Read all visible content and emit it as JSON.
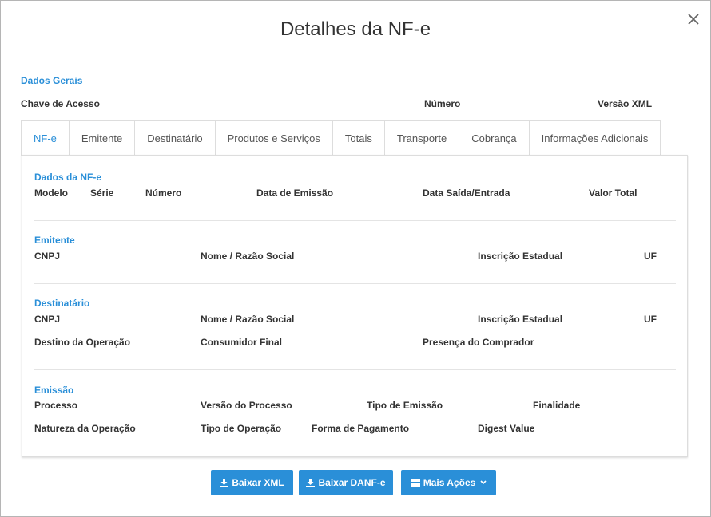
{
  "modal": {
    "title": "Detalhes da NF-e"
  },
  "general": {
    "section_title": "Dados Gerais",
    "access_key_label": "Chave de Acesso",
    "number_label": "Número",
    "xml_version_label": "Versão XML"
  },
  "tabs": [
    {
      "label": "NF-e",
      "active": true
    },
    {
      "label": "Emitente",
      "active": false
    },
    {
      "label": "Destinatário",
      "active": false
    },
    {
      "label": "Produtos e Serviços",
      "active": false
    },
    {
      "label": "Totais",
      "active": false
    },
    {
      "label": "Transporte",
      "active": false
    },
    {
      "label": "Cobrança",
      "active": false
    },
    {
      "label": "Informações Adicionais",
      "active": false
    }
  ],
  "nfe": {
    "title": "Dados da NF-e",
    "model": "Modelo",
    "series": "Série",
    "number": "Número",
    "issue_date": "Data de Emissão",
    "exit_entry_date": "Data Saída/Entrada",
    "total_value": "Valor Total"
  },
  "issuer": {
    "title": "Emitente",
    "cnpj": "CNPJ",
    "name": "Nome / Razão Social",
    "state_registration": "Inscrição Estadual",
    "uf": "UF"
  },
  "recipient": {
    "title": "Destinatário",
    "cnpj": "CNPJ",
    "name": "Nome / Razão Social",
    "state_registration": "Inscrição Estadual",
    "uf": "UF",
    "operation_destination": "Destino da Operação",
    "final_consumer": "Consumidor Final",
    "buyer_presence": "Presença do Comprador"
  },
  "emission": {
    "title": "Emissão",
    "process": "Processo",
    "process_version": "Versão do Processo",
    "emission_type": "Tipo de Emissão",
    "purpose": "Finalidade",
    "operation_nature": "Natureza da Operação",
    "operation_type": "Tipo de Operação",
    "payment_method": "Forma de Pagamento",
    "digest_value": "Digest Value"
  },
  "buttons": {
    "download_xml": "Baixar XML",
    "download_danfe": "Baixar DANF-e",
    "more_actions": "Mais Ações"
  },
  "colors": {
    "accent": "#2a8fd8",
    "text": "#333333",
    "border": "#dddddd"
  }
}
